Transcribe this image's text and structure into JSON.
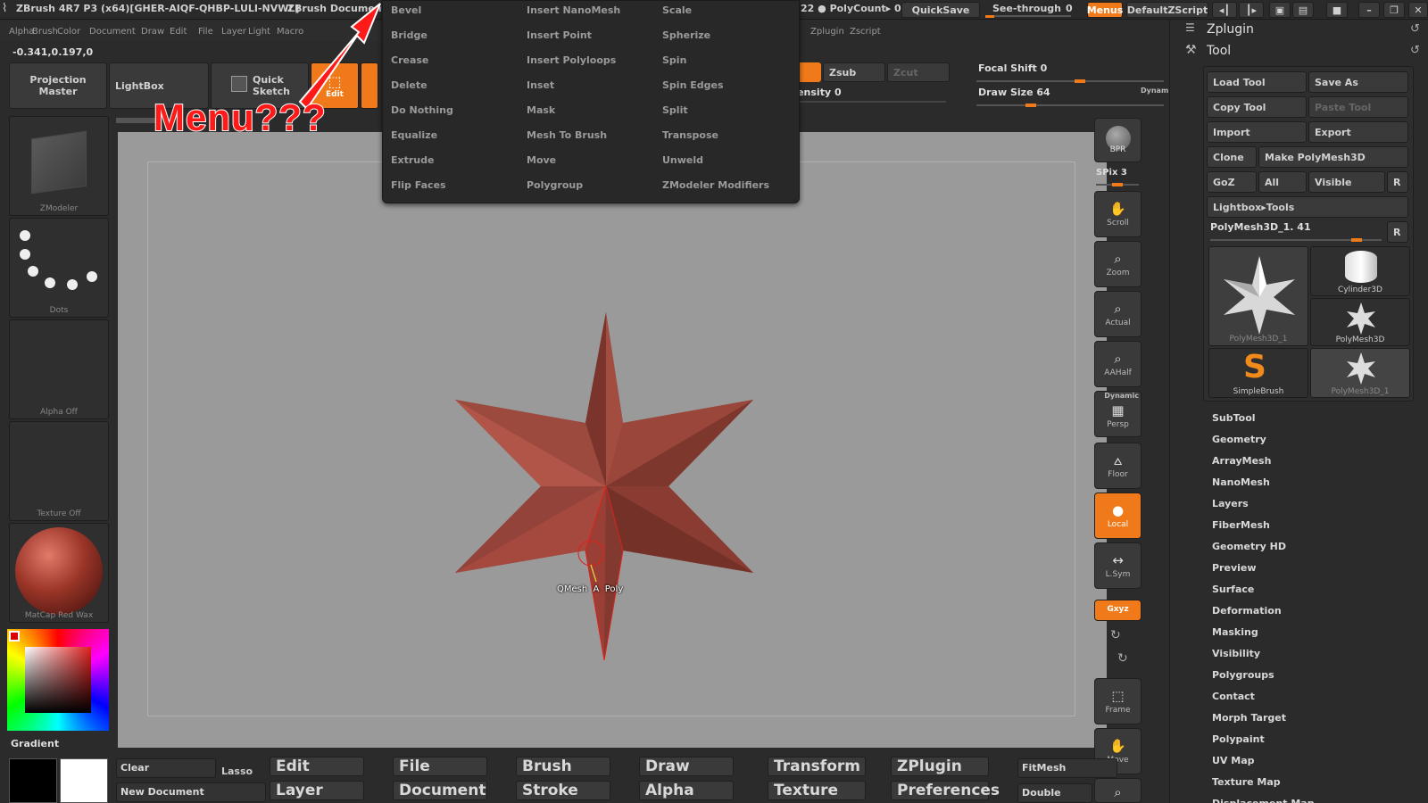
{
  "title_bar": {
    "app_title": "ZBrush 4R7 P3 (x64)[GHER-AIQF-QHBP-LULI-NVWL]",
    "document_label": "ZBrush Document",
    "polycount": "22 ● PolyCount▸ 0.",
    "quicksave": "QuickSave",
    "see_through": "See-through",
    "see_through_value": "0",
    "menus": "Menus",
    "default_zscript": "DefaultZScript"
  },
  "menu_bar": [
    "Alpha",
    "Brush",
    "Color",
    "Document",
    "Draw",
    "Edit",
    "File",
    "Layer",
    "Light",
    "Macro"
  ],
  "menu_bar_right": [
    "Zplugin",
    "Zscript"
  ],
  "coords": "-0.341,0.197,0",
  "left_toolbar": {
    "projection_master": "Projection\nMaster",
    "lightbox": "LightBox",
    "quick_sketch": "Quick\nSketch",
    "edit": "Edit"
  },
  "shelf": {
    "zadd_partial": "",
    "zsub": "Zsub",
    "zcut": "Zcut",
    "intensity": "ntensity 0",
    "focal_shift": "Focal Shift 0",
    "draw_size": "Draw Size 64",
    "dynamic": "Dynam"
  },
  "left_shelf": {
    "brush_label": "ZModeler",
    "stroke_label": "Dots",
    "alpha_label": "Alpha Off",
    "texture_label": "Texture Off",
    "material_label": "MatCap Red Wax",
    "gradient": "Gradient"
  },
  "popup_menu": {
    "col1": [
      "Bevel",
      "Bridge",
      "Crease",
      "Delete",
      "Do Nothing",
      "Equalize",
      "Extrude",
      "Flip Faces"
    ],
    "col2": [
      "Insert NanoMesh",
      "Insert Point",
      "Insert Polyloops",
      "Inset",
      "Mask",
      "Mesh To Brush",
      "Move",
      "Polygroup"
    ],
    "col3": [
      "Scale",
      "Spherize",
      "Spin",
      "Spin Edges",
      "Split",
      "Transpose",
      "Unweld",
      "ZModeler Modifiers"
    ]
  },
  "annotation": "Menu???",
  "canvas": {
    "cursor_label": "QMesh  A  Poly"
  },
  "right_nav": {
    "bpr": "BPR",
    "spix": "SPix 3",
    "scroll": "Scroll",
    "zoom": "Zoom",
    "actual": "Actual",
    "aahalf": "AAHalf",
    "dynamic": "Dynamic",
    "persp": "Persp",
    "floor": "Floor",
    "local": "Local",
    "lsym": "L.Sym",
    "xyz": "Gxyz",
    "frame": "Frame",
    "move": "Move"
  },
  "tool_palette": {
    "zplugin": "Zplugin",
    "tool": "Tool",
    "load_tool": "Load Tool",
    "save_as": "Save As",
    "copy_tool": "Copy Tool",
    "paste_tool": "Paste Tool",
    "import": "Import",
    "export": "Export",
    "clone": "Clone",
    "make_polymesh": "Make PolyMesh3D",
    "goz": "GoZ",
    "all": "All",
    "visible": "Visible",
    "r": "R",
    "lightbox_tools": "Lightbox▸Tools",
    "current_tool": "PolyMesh3D_1. 41",
    "thumbs": [
      "PolyMesh3D_1",
      "Cylinder3D",
      "PolyMesh3D",
      "SimpleBrush",
      "PolyMesh3D_1"
    ],
    "subpalettes": [
      "SubTool",
      "Geometry",
      "ArrayMesh",
      "NanoMesh",
      "Layers",
      "FiberMesh",
      "Geometry HD",
      "Preview",
      "Surface",
      "Deformation",
      "Masking",
      "Visibility",
      "Polygroups",
      "Contact",
      "Morph Target",
      "Polypaint",
      "UV Map",
      "Texture Map",
      "Displacement Map"
    ]
  },
  "bottom_bar": {
    "clear": "Clear",
    "lasso": "Lasso",
    "new_document": "New Document",
    "row1": [
      "Edit",
      "File",
      "Brush",
      "Draw",
      "Transform",
      "ZPlugin"
    ],
    "row2": [
      "Layer",
      "Document",
      "Stroke",
      "Alpha",
      "Texture",
      "Preferences"
    ],
    "fitmesh": "FitMesh",
    "double": "Double"
  },
  "colors": {
    "accent": "#f07a1a",
    "star": "#8e3f34",
    "canvas": "#9a9a9a",
    "annotation": "#ff1a1a"
  }
}
